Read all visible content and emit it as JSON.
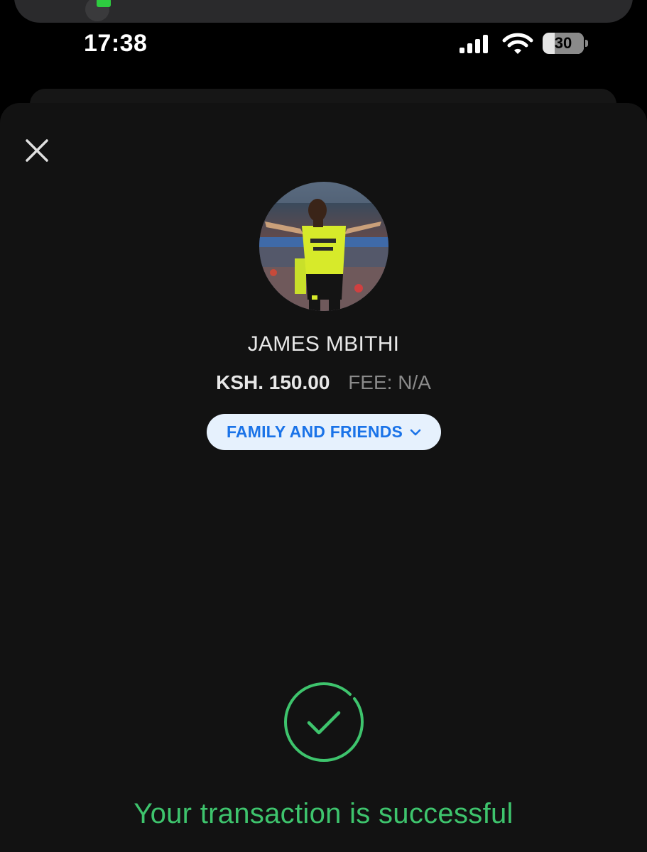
{
  "status_bar": {
    "time": "17:38",
    "battery_level": "30",
    "battery_fraction": 0.3
  },
  "icons": {
    "close": "close-icon",
    "signal": "cellular-signal-icon",
    "wifi": "wifi-icon",
    "chevron": "chevron-down-icon",
    "success": "check-circle-icon"
  },
  "recipient": {
    "name": "JAMES MBITHI",
    "amount": "KSH. 150.00",
    "fee": "FEE: N/A"
  },
  "category": {
    "label": "FAMILY AND FRIENDS"
  },
  "result": {
    "message": "Your transaction is successful"
  },
  "colors": {
    "background": "#121212",
    "success_green": "#3ec46d",
    "accent_blue": "#1a73e8",
    "pill_background": "#e6f1fd"
  }
}
